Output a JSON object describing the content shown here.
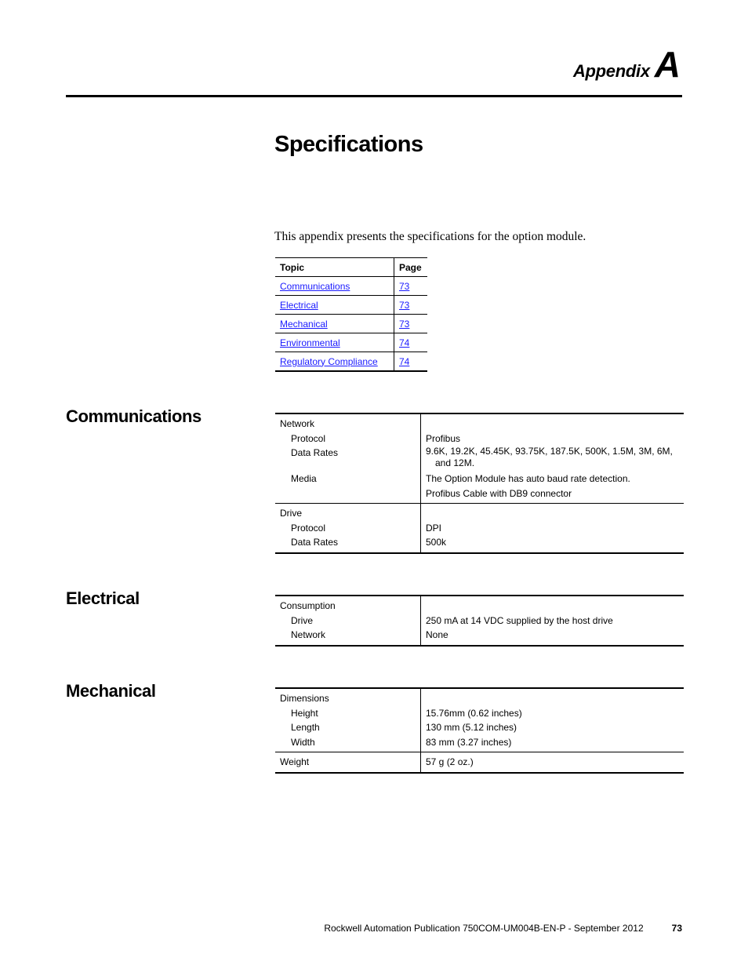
{
  "header": {
    "appendix_word": "Appendix",
    "appendix_letter": "A"
  },
  "title": "Specifications",
  "intro": "This appendix presents the specifications for the option module.",
  "toc": {
    "headers": [
      "Topic",
      "Page"
    ],
    "rows": [
      {
        "topic": "Communications",
        "page": "73"
      },
      {
        "topic": "Electrical",
        "page": "73"
      },
      {
        "topic": "Mechanical",
        "page": "73"
      },
      {
        "topic": "Environmental",
        "page": "74"
      },
      {
        "topic": "Regulatory Compliance",
        "page": "74"
      }
    ],
    "link_color": "#1a1aff"
  },
  "sections": {
    "communications": {
      "heading": "Communications",
      "network": {
        "label": "Network",
        "protocol_label": "Protocol",
        "protocol": "Profibus",
        "data_rates_label": "Data Rates",
        "data_rates": "9.6K, 19.2K, 45.45K, 93.75K, 187.5K, 500K, 1.5M, 3M, 6M, and 12M.",
        "media_label": "Media",
        "media_1": "The Option Module has auto baud rate detection.",
        "media_2": "Profibus Cable with DB9 connector"
      },
      "drive": {
        "label": "Drive",
        "protocol_label": "Protocol",
        "protocol": "DPI",
        "data_rates_label": "Data Rates",
        "data_rates": "500k"
      }
    },
    "electrical": {
      "heading": "Electrical",
      "consumption_label": "Consumption",
      "drive_label": "Drive",
      "drive": "250 mA at 14 VDC supplied by the host drive",
      "network_label": "Network",
      "network": "None"
    },
    "mechanical": {
      "heading": "Mechanical",
      "dimensions_label": "Dimensions",
      "height_label": "Height",
      "height": "15.76mm (0.62 inches)",
      "length_label": "Length",
      "length": "130 mm (5.12 inches)",
      "width_label": "Width",
      "width": "83 mm (3.27 inches)",
      "weight_label": "Weight",
      "weight": "57 g (2 oz.)"
    }
  },
  "footer": {
    "publication": "Rockwell Automation Publication 750COM-UM004B-EN-P - September 2012",
    "page": "73"
  }
}
